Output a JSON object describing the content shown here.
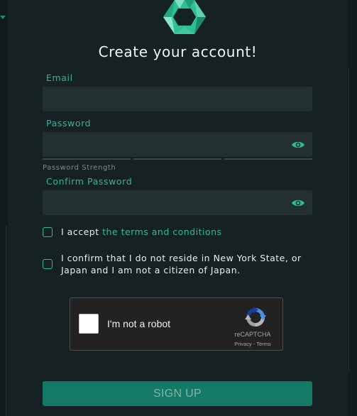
{
  "title": "Create your account!",
  "fields": {
    "email_label": "Email",
    "email_value": "",
    "password_label": "Password",
    "password_value": "",
    "password_strength_label": "Password Strength",
    "password_strength_level": 0,
    "confirm_label": "Confirm Password",
    "confirm_value": ""
  },
  "checks": {
    "terms_prefix": "I accept ",
    "terms_link": "the terms and conditions",
    "terms_checked": false,
    "residency_line1": "I confirm that I do not reside in New York State, or",
    "residency_line2": "Japan and I am not a citizen of Japan.",
    "residency_checked": false
  },
  "captcha": {
    "label": "I'm not a robot",
    "brand": "reCAPTCHA",
    "privacy": "Privacy",
    "separator": " - ",
    "terms": "Terms",
    "checked": false
  },
  "submit_label": "SIGN UP",
  "colors": {
    "accent": "#2fb899",
    "button": "#147a66",
    "field": "#22302f",
    "panel": "#162123"
  },
  "icons": [
    "logo-hexagon-icon",
    "eye-icon",
    "recaptcha-icon"
  ]
}
